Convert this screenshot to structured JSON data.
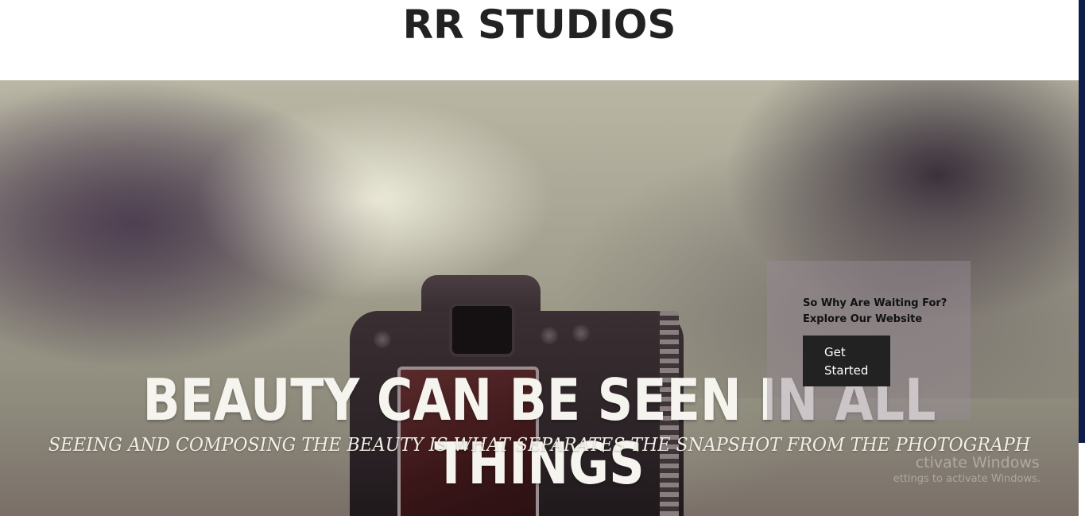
{
  "header": {
    "title": "RR STUDIOS"
  },
  "hero": {
    "headline": "BEAUTY CAN BE SEEN IN ALL THINGS",
    "subheadline": "SEEING AND COMPOSING THE BEAUTY IS WHAT SEPARATES THE SNAPSHOT FROM THE PHOTOGRAPH",
    "image_subject": "dslr-camera-photo"
  },
  "cta": {
    "text": "So Why Are Waiting For? Explore Our Website",
    "button_label": "Get Started"
  },
  "watermark": {
    "title": "ctivate Windows",
    "subtitle": "ettings to activate Windows."
  },
  "colors": {
    "title": "#222222",
    "button_bg": "#222222",
    "button_text": "#ffffff",
    "scroll_edge": "#0e1c4a"
  }
}
